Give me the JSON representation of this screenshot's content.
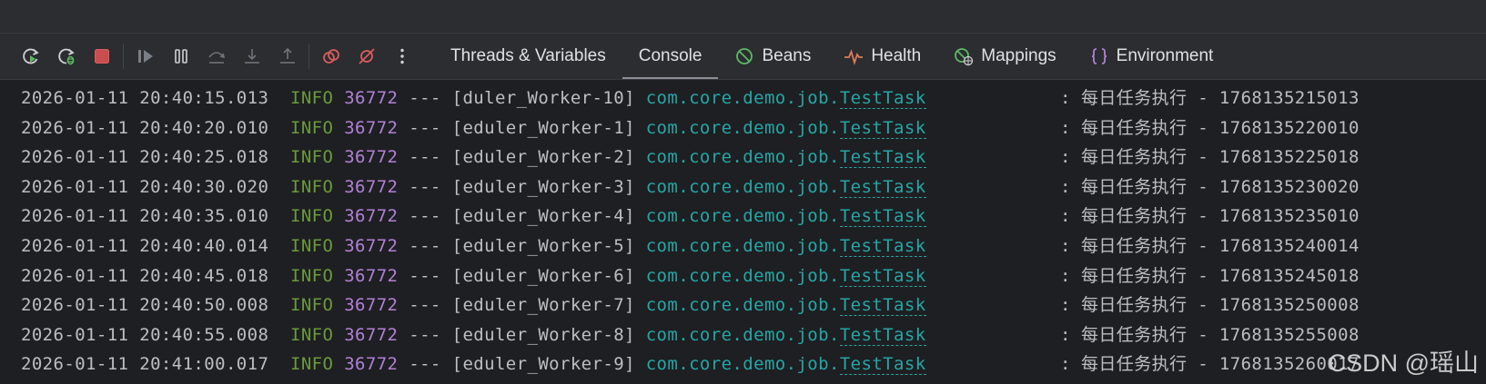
{
  "toolbar": {
    "buttons": [
      {
        "icon": "rerun-icon",
        "color": "#6e9fd9"
      },
      {
        "icon": "rerun-debug-icon",
        "color": "#6e9fd9"
      },
      {
        "icon": "stop-icon",
        "color": "#db5c5c"
      },
      {
        "icon": "resume-icon",
        "color": "#7a7e85"
      },
      {
        "icon": "pause-icon",
        "color": "#cfd1d5"
      },
      {
        "icon": "step-over-icon",
        "color": "#6f737a"
      },
      {
        "icon": "step-into-icon",
        "color": "#6f737a"
      },
      {
        "icon": "step-out-icon",
        "color": "#6f737a"
      },
      {
        "icon": "view-breakpoints-icon",
        "color": "#db5c5c"
      },
      {
        "icon": "mute-breakpoints-icon",
        "color": "#db5c5c"
      },
      {
        "icon": "more-options-icon",
        "color": "#cfd1d5"
      }
    ]
  },
  "tabs": [
    {
      "label": "Threads & Variables",
      "icon": ""
    },
    {
      "label": "Console",
      "icon": "",
      "active": true
    },
    {
      "label": "Beans",
      "icon": "beans-icon",
      "color": "#5fb865"
    },
    {
      "label": "Health",
      "icon": "health-icon",
      "color": "#e07a5a"
    },
    {
      "label": "Mappings",
      "icon": "mappings-icon",
      "color": "#5fb865"
    },
    {
      "label": "Environment",
      "icon": "environment-icon",
      "color": "#b180d7"
    }
  ],
  "log": {
    "rows": [
      {
        "ts": "2026-01-11 20:40:15.013",
        "level": "INFO",
        "pid": "36772",
        "sep": "---",
        "thread": "[duler_Worker-10]",
        "pkg": "com.core.demo.job.",
        "cls": "TestTask",
        "colon": ":",
        "msg": "每日任务执行 - 1768135215013"
      },
      {
        "ts": "2026-01-11 20:40:20.010",
        "level": "INFO",
        "pid": "36772",
        "sep": "---",
        "thread": "[eduler_Worker-1]",
        "pkg": "com.core.demo.job.",
        "cls": "TestTask",
        "colon": ":",
        "msg": "每日任务执行 - 1768135220010"
      },
      {
        "ts": "2026-01-11 20:40:25.018",
        "level": "INFO",
        "pid": "36772",
        "sep": "---",
        "thread": "[eduler_Worker-2]",
        "pkg": "com.core.demo.job.",
        "cls": "TestTask",
        "colon": ":",
        "msg": "每日任务执行 - 1768135225018"
      },
      {
        "ts": "2026-01-11 20:40:30.020",
        "level": "INFO",
        "pid": "36772",
        "sep": "---",
        "thread": "[eduler_Worker-3]",
        "pkg": "com.core.demo.job.",
        "cls": "TestTask",
        "colon": ":",
        "msg": "每日任务执行 - 1768135230020"
      },
      {
        "ts": "2026-01-11 20:40:35.010",
        "level": "INFO",
        "pid": "36772",
        "sep": "---",
        "thread": "[eduler_Worker-4]",
        "pkg": "com.core.demo.job.",
        "cls": "TestTask",
        "colon": ":",
        "msg": "每日任务执行 - 1768135235010"
      },
      {
        "ts": "2026-01-11 20:40:40.014",
        "level": "INFO",
        "pid": "36772",
        "sep": "---",
        "thread": "[eduler_Worker-5]",
        "pkg": "com.core.demo.job.",
        "cls": "TestTask",
        "colon": ":",
        "msg": "每日任务执行 - 1768135240014"
      },
      {
        "ts": "2026-01-11 20:40:45.018",
        "level": "INFO",
        "pid": "36772",
        "sep": "---",
        "thread": "[eduler_Worker-6]",
        "pkg": "com.core.demo.job.",
        "cls": "TestTask",
        "colon": ":",
        "msg": "每日任务执行 - 1768135245018"
      },
      {
        "ts": "2026-01-11 20:40:50.008",
        "level": "INFO",
        "pid": "36772",
        "sep": "---",
        "thread": "[eduler_Worker-7]",
        "pkg": "com.core.demo.job.",
        "cls": "TestTask",
        "colon": ":",
        "msg": "每日任务执行 - 1768135250008"
      },
      {
        "ts": "2026-01-11 20:40:55.008",
        "level": "INFO",
        "pid": "36772",
        "sep": "---",
        "thread": "[eduler_Worker-8]",
        "pkg": "com.core.demo.job.",
        "cls": "TestTask",
        "colon": ":",
        "msg": "每日任务执行 - 1768135255008"
      },
      {
        "ts": "2026-01-11 20:41:00.017",
        "level": "INFO",
        "pid": "36772",
        "sep": "---",
        "thread": "[eduler_Worker-9]",
        "pkg": "com.core.demo.job.",
        "cls": "TestTask",
        "colon": ":",
        "msg": "每日任务执行 - 1768135260017"
      }
    ]
  },
  "watermark": "CSDN @瑶山"
}
